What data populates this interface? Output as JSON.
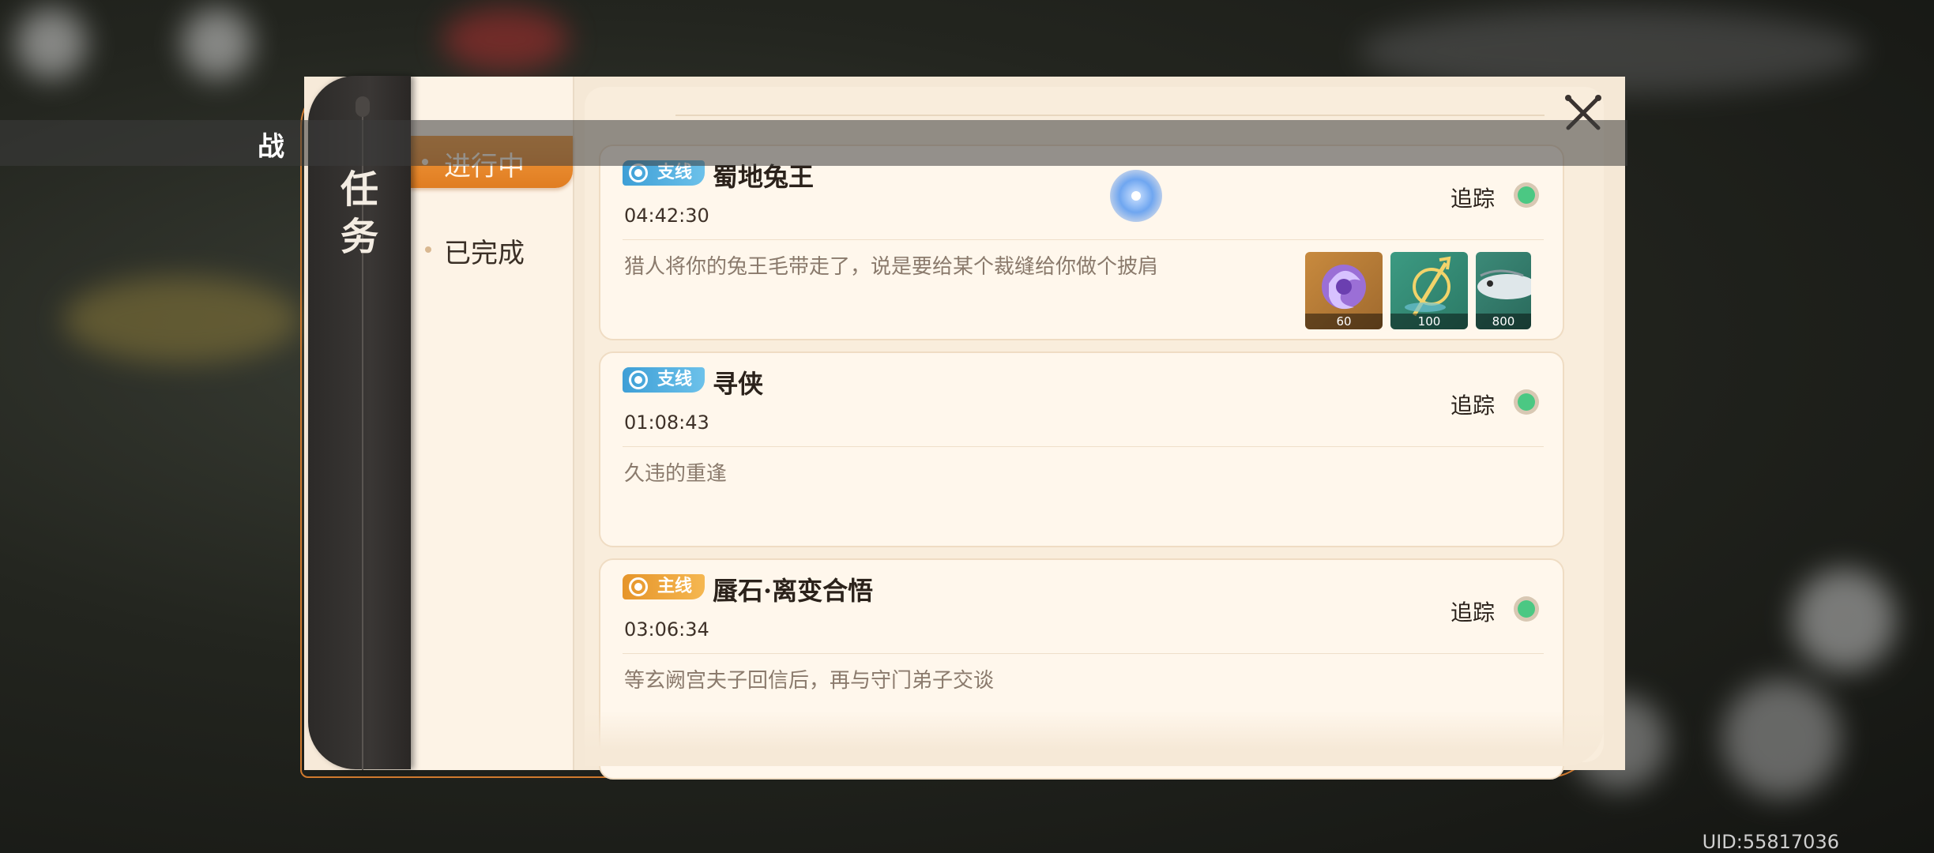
{
  "top_strip": {
    "label": "战"
  },
  "sidebar": {
    "title": "任务"
  },
  "tabs": [
    {
      "label": "进行中",
      "active": true
    },
    {
      "label": "已完成",
      "active": false
    }
  ],
  "quests": [
    {
      "tag": "支线",
      "tag_type": "side",
      "title": "蜀地兔王",
      "time": "04:42:30",
      "desc": "猎人将你的兔王毛带走了，说是要给某个裁缝给你做个披肩",
      "track_label": "追踪",
      "tracked": true,
      "rewards": [
        {
          "icon": "purple-orb-reward-icon",
          "count": "60"
        },
        {
          "icon": "golden-trident-reward-icon",
          "count": "100"
        },
        {
          "icon": "fish-reward-icon",
          "count": "800"
        }
      ]
    },
    {
      "tag": "支线",
      "tag_type": "side",
      "title": "寻侠",
      "time": "01:08:43",
      "desc": "久违的重逢",
      "track_label": "追踪",
      "tracked": true,
      "rewards": []
    },
    {
      "tag": "主线",
      "tag_type": "main",
      "title": "蜃石·离变合悟",
      "time": "03:06:34",
      "desc": "等玄阙宫夫子回信后，再与守门弟子交谈",
      "track_label": "追踪",
      "tracked": true,
      "rewards": []
    }
  ],
  "uid": "UID:55817036",
  "colors": {
    "accent_orange": "#e88a2d",
    "side_tag": "#4aaee0",
    "main_tag": "#eea33a",
    "track_on": "#4bc883"
  }
}
